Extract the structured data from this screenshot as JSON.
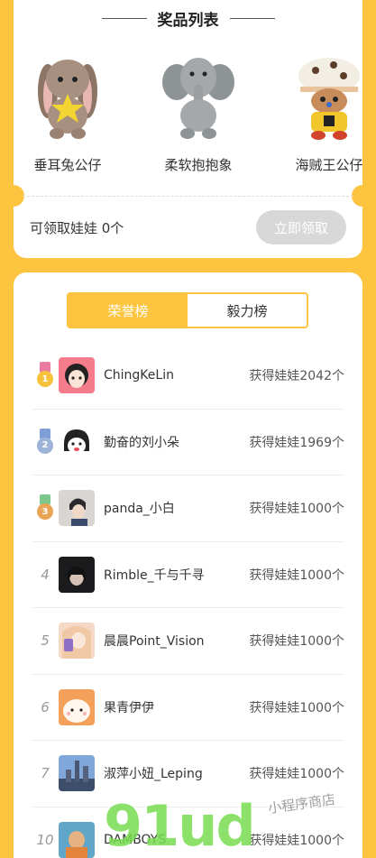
{
  "prize_section": {
    "title": "奖品列表",
    "items": [
      {
        "name": "垂耳兔公仔",
        "icon": "bunny-plush-image"
      },
      {
        "name": "柔软抱抱象",
        "icon": "elephant-plush-image"
      },
      {
        "name": "海贼王公仔",
        "icon": "chopper-plush-image"
      }
    ],
    "claim_text": "可领取娃娃 0个",
    "claim_button": "立即领取"
  },
  "ranking": {
    "tabs": [
      {
        "label": "荣誉榜",
        "active": true
      },
      {
        "label": "毅力榜",
        "active": false
      }
    ],
    "rows": [
      {
        "rank": "1",
        "name": "ChingKeLin",
        "count": "获得娃娃2042个",
        "medal": "gold"
      },
      {
        "rank": "2",
        "name": "勤奋的刘小朵",
        "count": "获得娃娃1969个",
        "medal": "silver"
      },
      {
        "rank": "3",
        "name": "panda_小白",
        "count": "获得娃娃1000个",
        "medal": "bronze"
      },
      {
        "rank": "4",
        "name": "Rimble_千与千寻",
        "count": "获得娃娃1000个"
      },
      {
        "rank": "5",
        "name": "晨晨Point_Vision",
        "count": "获得娃娃1000个"
      },
      {
        "rank": "6",
        "name": "果青伊伊",
        "count": "获得娃娃1000个"
      },
      {
        "rank": "7",
        "name": "淑萍小妞_Leping",
        "count": "获得娃娃1000个"
      },
      {
        "rank": "10",
        "name": "DAMBOYS",
        "count": "获得娃娃1000个"
      }
    ]
  },
  "watermark": {
    "brand": "91ud",
    "sub": "小程序商店"
  },
  "colors": {
    "accent": "#FDC440",
    "disabled_button": "#D8D8D8",
    "gold": "#F6C23C",
    "silver": "#9DB3D8",
    "bronze": "#E9A455"
  }
}
